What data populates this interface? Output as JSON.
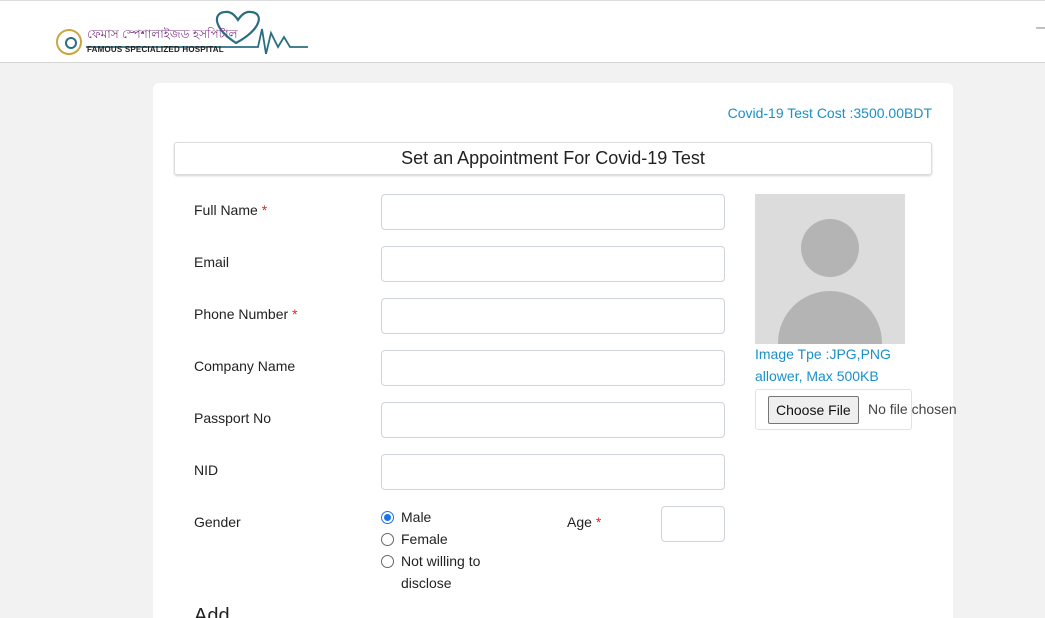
{
  "header": {
    "logo_bengali": "ফেমাস স্পেশালাইজড হসপিটাল",
    "logo_english": "FAMOUS SPECIALIZED HOSPITAL",
    "edge_glyph": "–"
  },
  "form": {
    "cost_text": "Covid-19 Test Cost :3500.00BDT",
    "title": "Set an Appointment For Covid-19 Test",
    "required_mark": "*",
    "fields": {
      "full_name": "Full Name",
      "email": "Email",
      "phone": "Phone Number",
      "company": "Company Name",
      "passport": "Passport No",
      "nid": "NID",
      "gender": "Gender",
      "age": "Age"
    },
    "gender_options": [
      "Male",
      "Female",
      "Not willing to disclose"
    ],
    "gender_selected": "Male",
    "image_note": "Image Tpe :JPG,PNG allower, Max 500KB",
    "file_button": "Choose File",
    "file_status": "No file chosen",
    "next_heading_partial": "Add"
  },
  "colors": {
    "accent": "#1a90c8",
    "required": "#d9262b",
    "radio_checked": "#1a73e8"
  }
}
